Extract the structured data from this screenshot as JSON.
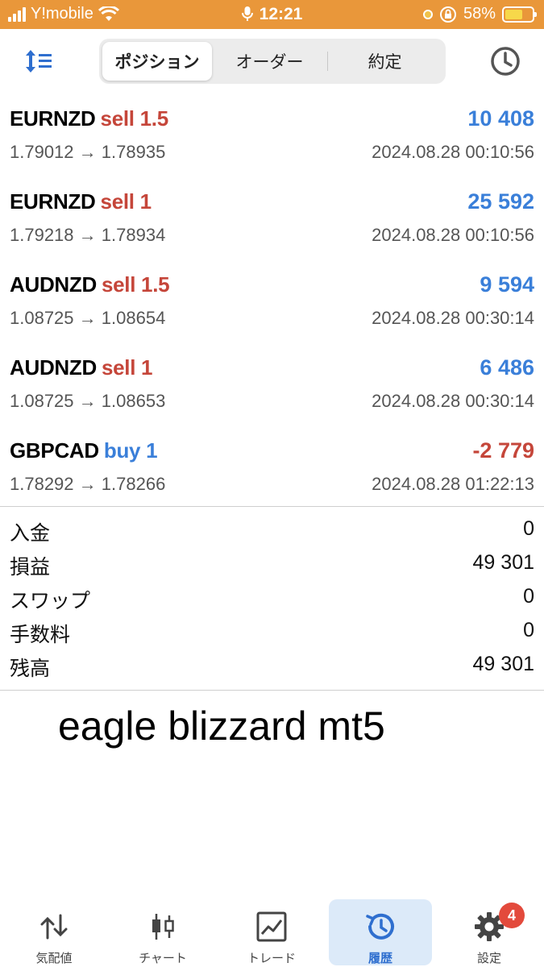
{
  "status_bar": {
    "carrier": "Y!mobile",
    "time": "12:21",
    "battery_percent": "58%"
  },
  "tabs": [
    {
      "label": "ポジション",
      "active": true
    },
    {
      "label": "オーダー",
      "active": false
    },
    {
      "label": "約定",
      "active": false
    }
  ],
  "deals": [
    {
      "symbol": "EURNZD",
      "side": "sell 1.5",
      "profit": "10 408",
      "open_price": "1.79012",
      "close_price": "1.78935",
      "time": "2024.08.28 00:10:56"
    },
    {
      "symbol": "EURNZD",
      "side": "sell 1",
      "profit": "25 592",
      "open_price": "1.79218",
      "close_price": "1.78934",
      "time": "2024.08.28 00:10:56"
    },
    {
      "symbol": "AUDNZD",
      "side": "sell 1.5",
      "profit": "9 594",
      "open_price": "1.08725",
      "close_price": "1.08654",
      "time": "2024.08.28 00:30:14"
    },
    {
      "symbol": "AUDNZD",
      "side": "sell 1",
      "profit": "6 486",
      "open_price": "1.08725",
      "close_price": "1.08653",
      "time": "2024.08.28 00:30:14"
    },
    {
      "symbol": "GBPCAD",
      "side": "buy 1",
      "profit": "-2 779",
      "open_price": "1.78292",
      "close_price": "1.78266",
      "time": "2024.08.28 01:22:13"
    }
  ],
  "price_arrow": "→",
  "summary": [
    {
      "label": "入金",
      "value": "0"
    },
    {
      "label": "損益",
      "value": "49 301"
    },
    {
      "label": "スワップ",
      "value": "0"
    },
    {
      "label": "手数料",
      "value": "0"
    },
    {
      "label": "残高",
      "value": "49 301"
    }
  ],
  "caption": "eagle blizzard mt5",
  "bottom_nav": [
    {
      "label": "気配値",
      "icon": "quotes-arrows-icon"
    },
    {
      "label": "チャート",
      "icon": "candlestick-icon"
    },
    {
      "label": "トレード",
      "icon": "trade-chart-icon"
    },
    {
      "label": "履歴",
      "icon": "history-icon",
      "active": true
    },
    {
      "label": "設定",
      "icon": "gear-icon",
      "badge": "4"
    }
  ],
  "colors": {
    "status_bar": "#e9973a",
    "sell": "#c5463a",
    "buy": "#3a7fd9",
    "profit_positive": "#3a7fd9",
    "profit_negative": "#c5463a",
    "active_tab": "#2f6fcf",
    "badge": "#e34a3c"
  }
}
